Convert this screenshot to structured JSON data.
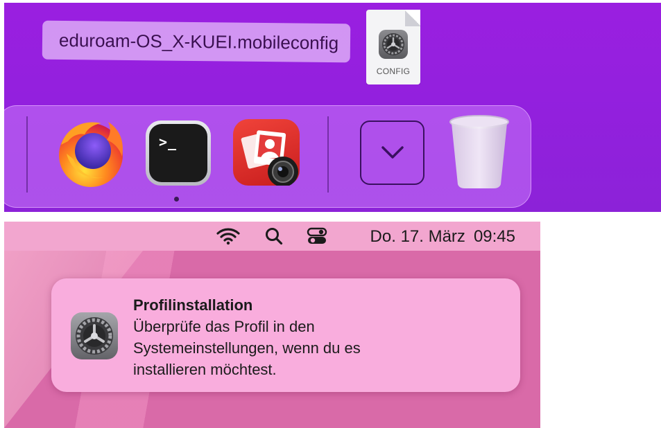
{
  "drag": {
    "filename": "eduroam-OS_X-KUEI.mobileconfig",
    "file_icon_label": "CONFIG",
    "file_icon": "gear-icon"
  },
  "dock": {
    "apps": [
      {
        "name": "Firefox",
        "icon": "firefox-icon",
        "running": false
      },
      {
        "name": "Terminal",
        "icon": "terminal-icon",
        "running": true,
        "prompt": ">_"
      },
      {
        "name": "Photo Booth",
        "icon": "photo-booth-icon",
        "running": false
      },
      {
        "name": "Downloads",
        "icon": "chevron-down-icon",
        "running": false
      },
      {
        "name": "Trash",
        "icon": "trash-icon",
        "running": false
      }
    ]
  },
  "menubar": {
    "icons": [
      "wifi-icon",
      "search-icon",
      "control-center-icon"
    ],
    "date": "Do. 17. März",
    "time": "09:45"
  },
  "notification": {
    "icon": "system-preferences-icon",
    "title": "Profilinstallation",
    "body_lines": [
      "Überprüfe das Profil in den",
      "Systemeinstellungen, wenn du es",
      "installieren möchtest."
    ]
  },
  "colors": {
    "desktop_purple": "#9320de",
    "menubar_pink": "#f2a6cf",
    "notification_pink": "#f9addd",
    "wallpaper_pink": "#d96aa8"
  }
}
